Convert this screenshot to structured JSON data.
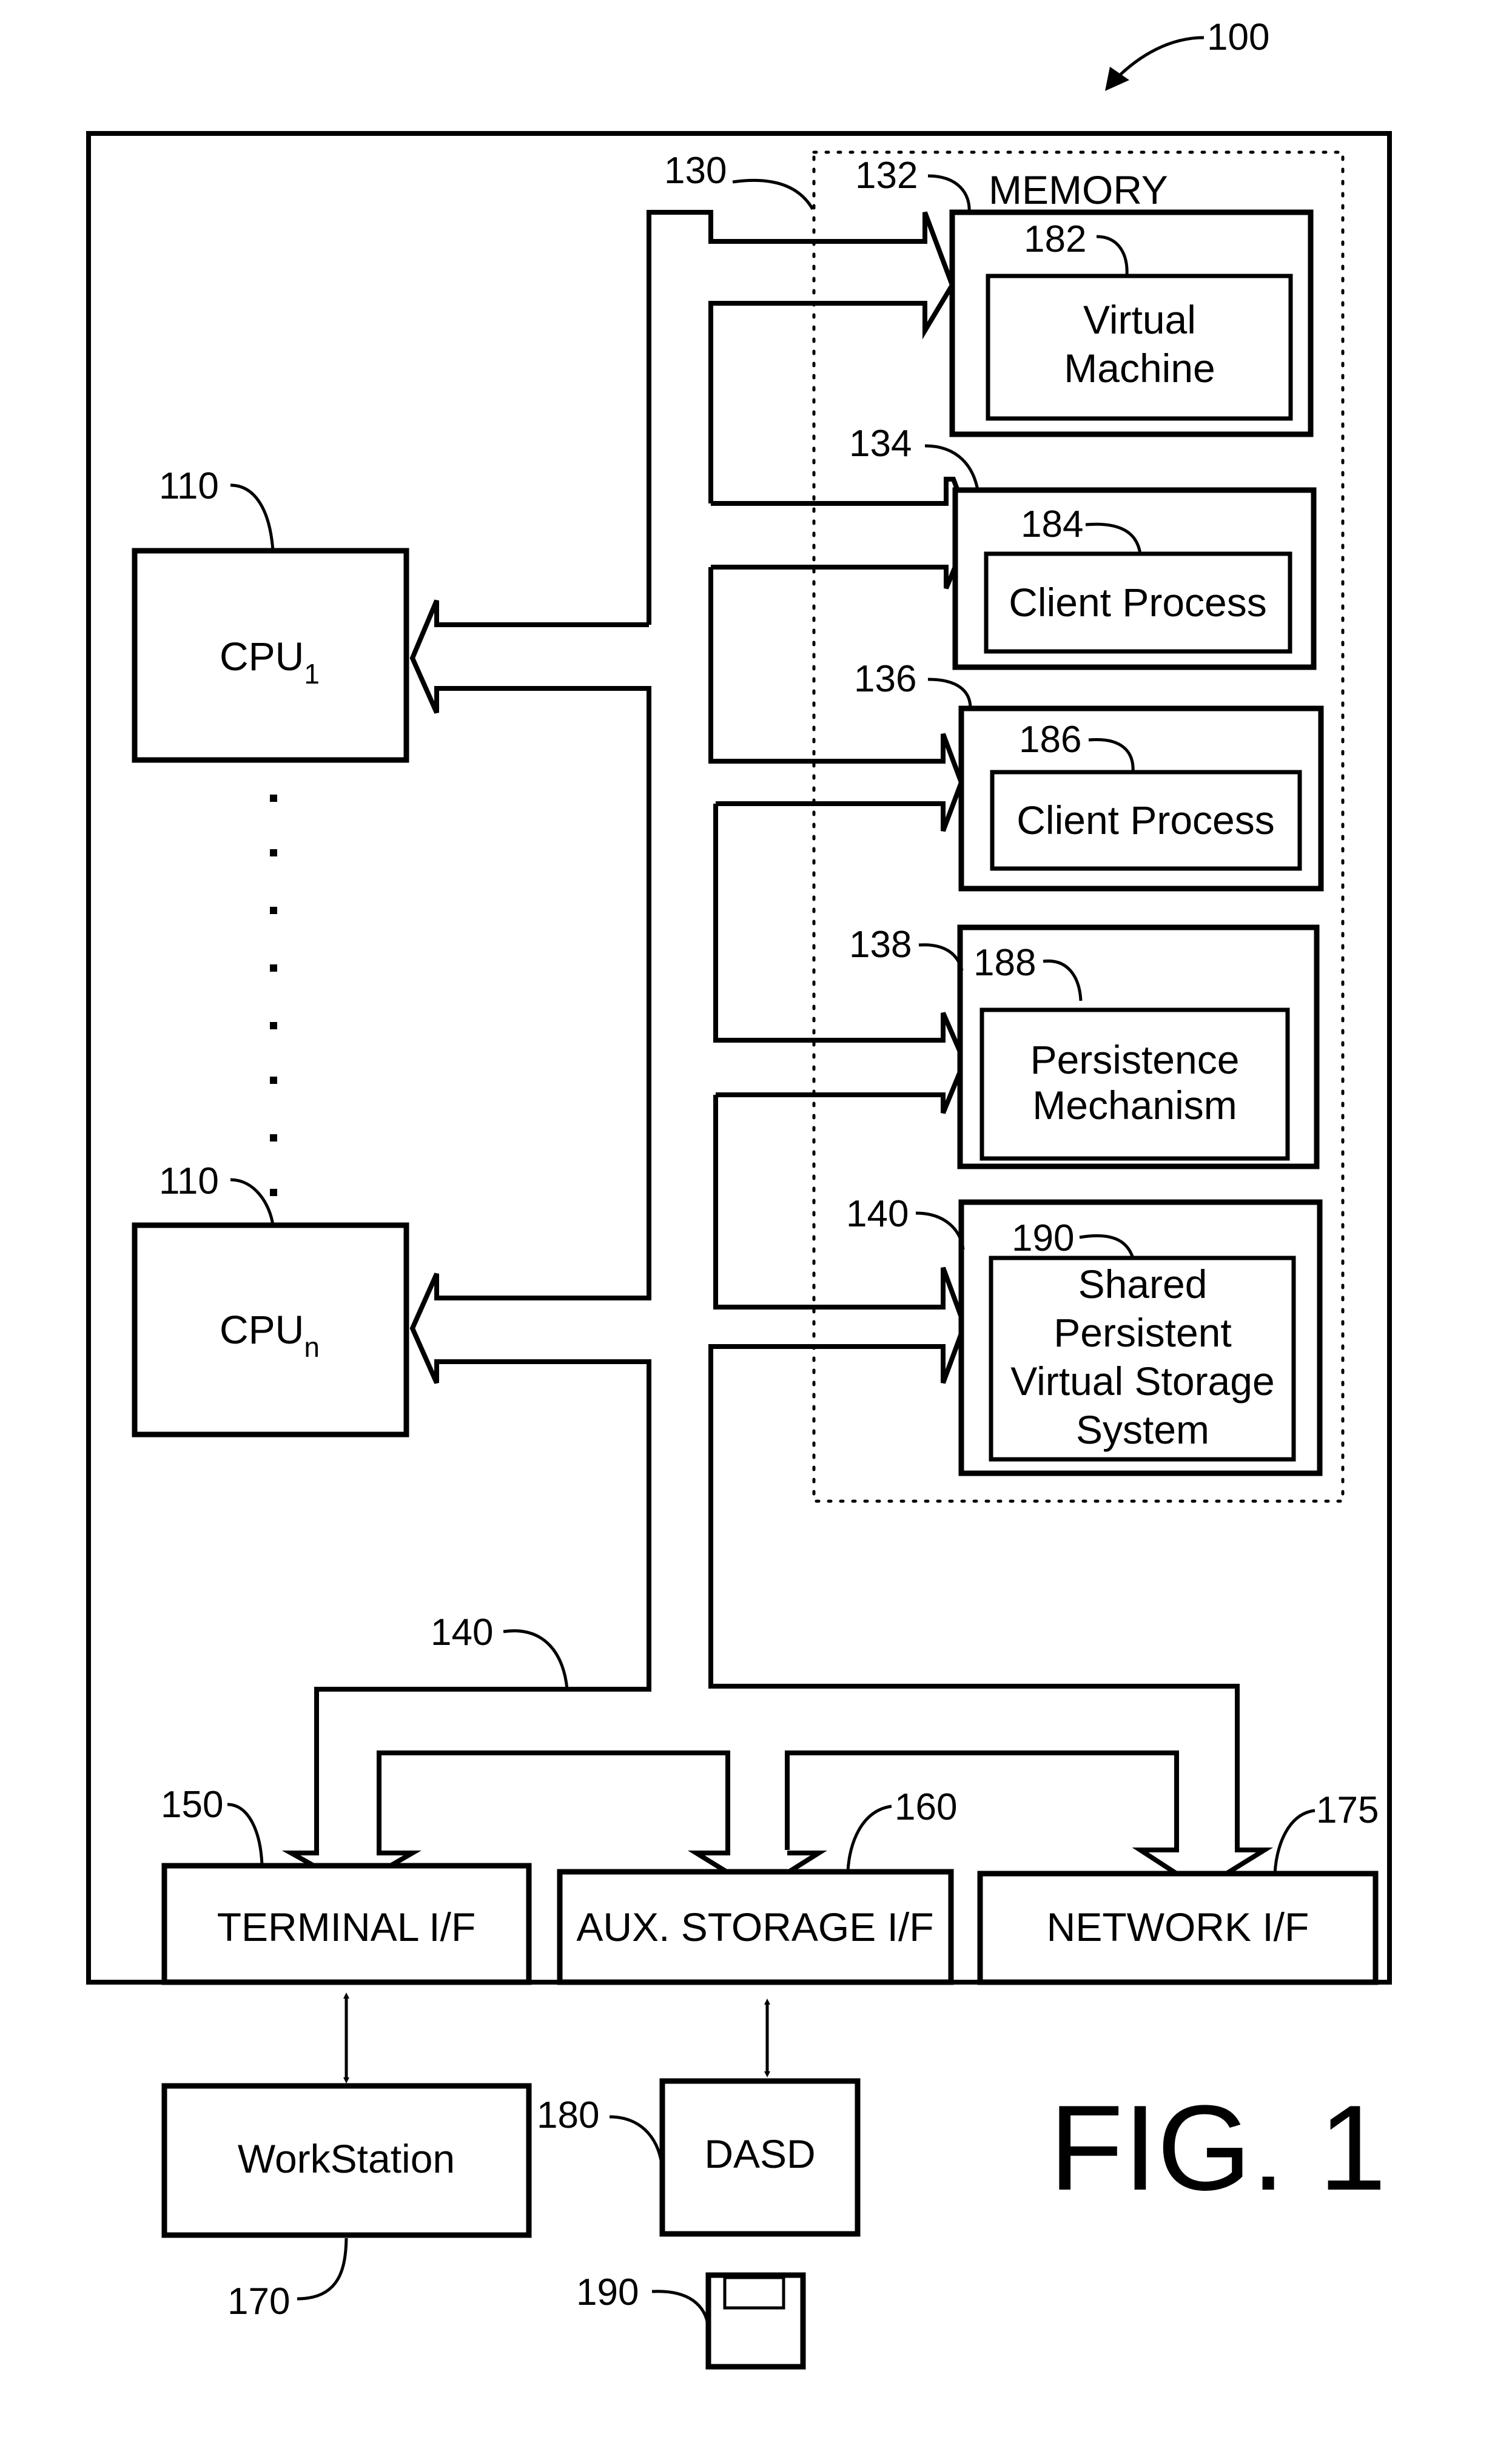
{
  "figure": {
    "title": "FIG. 1",
    "system_ref": "100"
  },
  "cpus": [
    {
      "ref": "110",
      "name": "CPU",
      "subscript": "1"
    },
    {
      "ref": "110",
      "name": "CPU",
      "subscript": "n"
    }
  ],
  "bus": {
    "main_ref": "130",
    "lower_ref": "140"
  },
  "memory": {
    "label": "MEMORY",
    "slots": [
      {
        "ref": "132",
        "inner_ref": "182",
        "lines": [
          "Virtual",
          "Machine"
        ]
      },
      {
        "ref": "134",
        "inner_ref": "184",
        "lines": [
          "Client Process"
        ]
      },
      {
        "ref": "136",
        "inner_ref": "186",
        "lines": [
          "Client Process"
        ]
      },
      {
        "ref": "138",
        "inner_ref": "188",
        "lines": [
          "Persistence",
          "Mechanism"
        ]
      },
      {
        "ref": "140",
        "inner_ref": "190",
        "lines": [
          "Shared",
          "Persistent",
          "Virtual Storage",
          "System"
        ]
      }
    ]
  },
  "interfaces": [
    {
      "ref": "150",
      "label": "TERMINAL I/F"
    },
    {
      "ref": "160",
      "label": "AUX. STORAGE I/F"
    },
    {
      "ref": "175",
      "label": "NETWORK I/F"
    }
  ],
  "peripherals": {
    "workstation": {
      "ref": "170",
      "label": "WorkStation"
    },
    "dasd": {
      "ref": "180",
      "label": "DASD"
    },
    "disk": {
      "ref": "190"
    }
  }
}
